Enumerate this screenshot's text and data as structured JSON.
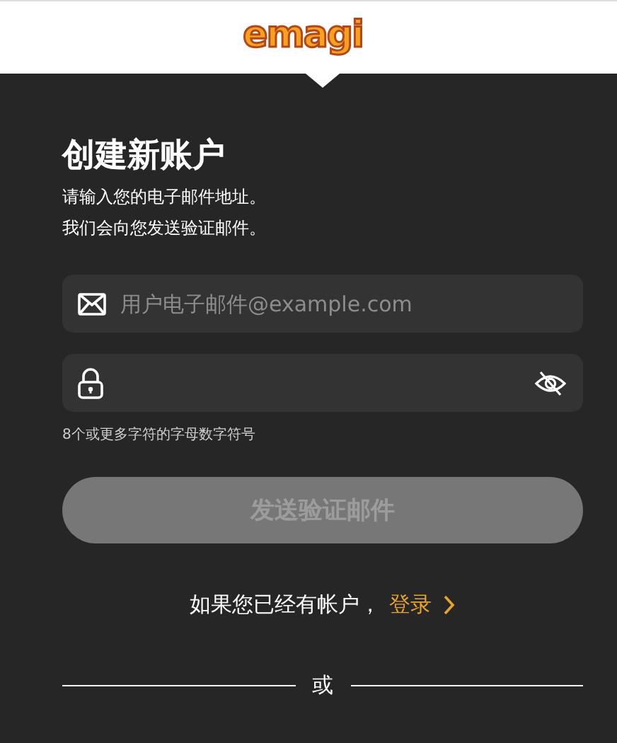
{
  "header": {
    "logo": "emagi"
  },
  "form": {
    "title": "创建新账户",
    "intro": [
      "请输入您的电子邮件地址。",
      "我们会向您发送验证邮件。"
    ],
    "email": {
      "placeholder": "用户电子邮件@example.com"
    },
    "password": {
      "revealed": false,
      "hint": "8个或更多字符的字母数字符号"
    },
    "submit": {
      "label": "发送验证邮件",
      "disabled": true
    }
  },
  "signin": {
    "text": "如果您已经有帐户，",
    "link": "登录"
  },
  "divider": {
    "label": "或"
  }
}
